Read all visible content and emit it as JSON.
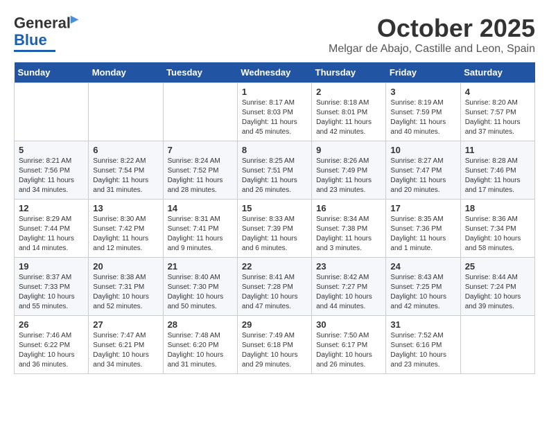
{
  "header": {
    "logo_line1": "General",
    "logo_line2": "Blue",
    "month": "October 2025",
    "location": "Melgar de Abajo, Castille and Leon, Spain"
  },
  "weekdays": [
    "Sunday",
    "Monday",
    "Tuesday",
    "Wednesday",
    "Thursday",
    "Friday",
    "Saturday"
  ],
  "weeks": [
    [
      {
        "day": "",
        "sunrise": "",
        "sunset": "",
        "daylight": ""
      },
      {
        "day": "",
        "sunrise": "",
        "sunset": "",
        "daylight": ""
      },
      {
        "day": "",
        "sunrise": "",
        "sunset": "",
        "daylight": ""
      },
      {
        "day": "1",
        "sunrise": "Sunrise: 8:17 AM",
        "sunset": "Sunset: 8:03 PM",
        "daylight": "Daylight: 11 hours and 45 minutes."
      },
      {
        "day": "2",
        "sunrise": "Sunrise: 8:18 AM",
        "sunset": "Sunset: 8:01 PM",
        "daylight": "Daylight: 11 hours and 42 minutes."
      },
      {
        "day": "3",
        "sunrise": "Sunrise: 8:19 AM",
        "sunset": "Sunset: 7:59 PM",
        "daylight": "Daylight: 11 hours and 40 minutes."
      },
      {
        "day": "4",
        "sunrise": "Sunrise: 8:20 AM",
        "sunset": "Sunset: 7:57 PM",
        "daylight": "Daylight: 11 hours and 37 minutes."
      }
    ],
    [
      {
        "day": "5",
        "sunrise": "Sunrise: 8:21 AM",
        "sunset": "Sunset: 7:56 PM",
        "daylight": "Daylight: 11 hours and 34 minutes."
      },
      {
        "day": "6",
        "sunrise": "Sunrise: 8:22 AM",
        "sunset": "Sunset: 7:54 PM",
        "daylight": "Daylight: 11 hours and 31 minutes."
      },
      {
        "day": "7",
        "sunrise": "Sunrise: 8:24 AM",
        "sunset": "Sunset: 7:52 PM",
        "daylight": "Daylight: 11 hours and 28 minutes."
      },
      {
        "day": "8",
        "sunrise": "Sunrise: 8:25 AM",
        "sunset": "Sunset: 7:51 PM",
        "daylight": "Daylight: 11 hours and 26 minutes."
      },
      {
        "day": "9",
        "sunrise": "Sunrise: 8:26 AM",
        "sunset": "Sunset: 7:49 PM",
        "daylight": "Daylight: 11 hours and 23 minutes."
      },
      {
        "day": "10",
        "sunrise": "Sunrise: 8:27 AM",
        "sunset": "Sunset: 7:47 PM",
        "daylight": "Daylight: 11 hours and 20 minutes."
      },
      {
        "day": "11",
        "sunrise": "Sunrise: 8:28 AM",
        "sunset": "Sunset: 7:46 PM",
        "daylight": "Daylight: 11 hours and 17 minutes."
      }
    ],
    [
      {
        "day": "12",
        "sunrise": "Sunrise: 8:29 AM",
        "sunset": "Sunset: 7:44 PM",
        "daylight": "Daylight: 11 hours and 14 minutes."
      },
      {
        "day": "13",
        "sunrise": "Sunrise: 8:30 AM",
        "sunset": "Sunset: 7:42 PM",
        "daylight": "Daylight: 11 hours and 12 minutes."
      },
      {
        "day": "14",
        "sunrise": "Sunrise: 8:31 AM",
        "sunset": "Sunset: 7:41 PM",
        "daylight": "Daylight: 11 hours and 9 minutes."
      },
      {
        "day": "15",
        "sunrise": "Sunrise: 8:33 AM",
        "sunset": "Sunset: 7:39 PM",
        "daylight": "Daylight: 11 hours and 6 minutes."
      },
      {
        "day": "16",
        "sunrise": "Sunrise: 8:34 AM",
        "sunset": "Sunset: 7:38 PM",
        "daylight": "Daylight: 11 hours and 3 minutes."
      },
      {
        "day": "17",
        "sunrise": "Sunrise: 8:35 AM",
        "sunset": "Sunset: 7:36 PM",
        "daylight": "Daylight: 11 hours and 1 minute."
      },
      {
        "day": "18",
        "sunrise": "Sunrise: 8:36 AM",
        "sunset": "Sunset: 7:34 PM",
        "daylight": "Daylight: 10 hours and 58 minutes."
      }
    ],
    [
      {
        "day": "19",
        "sunrise": "Sunrise: 8:37 AM",
        "sunset": "Sunset: 7:33 PM",
        "daylight": "Daylight: 10 hours and 55 minutes."
      },
      {
        "day": "20",
        "sunrise": "Sunrise: 8:38 AM",
        "sunset": "Sunset: 7:31 PM",
        "daylight": "Daylight: 10 hours and 52 minutes."
      },
      {
        "day": "21",
        "sunrise": "Sunrise: 8:40 AM",
        "sunset": "Sunset: 7:30 PM",
        "daylight": "Daylight: 10 hours and 50 minutes."
      },
      {
        "day": "22",
        "sunrise": "Sunrise: 8:41 AM",
        "sunset": "Sunset: 7:28 PM",
        "daylight": "Daylight: 10 hours and 47 minutes."
      },
      {
        "day": "23",
        "sunrise": "Sunrise: 8:42 AM",
        "sunset": "Sunset: 7:27 PM",
        "daylight": "Daylight: 10 hours and 44 minutes."
      },
      {
        "day": "24",
        "sunrise": "Sunrise: 8:43 AM",
        "sunset": "Sunset: 7:25 PM",
        "daylight": "Daylight: 10 hours and 42 minutes."
      },
      {
        "day": "25",
        "sunrise": "Sunrise: 8:44 AM",
        "sunset": "Sunset: 7:24 PM",
        "daylight": "Daylight: 10 hours and 39 minutes."
      }
    ],
    [
      {
        "day": "26",
        "sunrise": "Sunrise: 7:46 AM",
        "sunset": "Sunset: 6:22 PM",
        "daylight": "Daylight: 10 hours and 36 minutes."
      },
      {
        "day": "27",
        "sunrise": "Sunrise: 7:47 AM",
        "sunset": "Sunset: 6:21 PM",
        "daylight": "Daylight: 10 hours and 34 minutes."
      },
      {
        "day": "28",
        "sunrise": "Sunrise: 7:48 AM",
        "sunset": "Sunset: 6:20 PM",
        "daylight": "Daylight: 10 hours and 31 minutes."
      },
      {
        "day": "29",
        "sunrise": "Sunrise: 7:49 AM",
        "sunset": "Sunset: 6:18 PM",
        "daylight": "Daylight: 10 hours and 29 minutes."
      },
      {
        "day": "30",
        "sunrise": "Sunrise: 7:50 AM",
        "sunset": "Sunset: 6:17 PM",
        "daylight": "Daylight: 10 hours and 26 minutes."
      },
      {
        "day": "31",
        "sunrise": "Sunrise: 7:52 AM",
        "sunset": "Sunset: 6:16 PM",
        "daylight": "Daylight: 10 hours and 23 minutes."
      },
      {
        "day": "",
        "sunrise": "",
        "sunset": "",
        "daylight": ""
      }
    ]
  ]
}
